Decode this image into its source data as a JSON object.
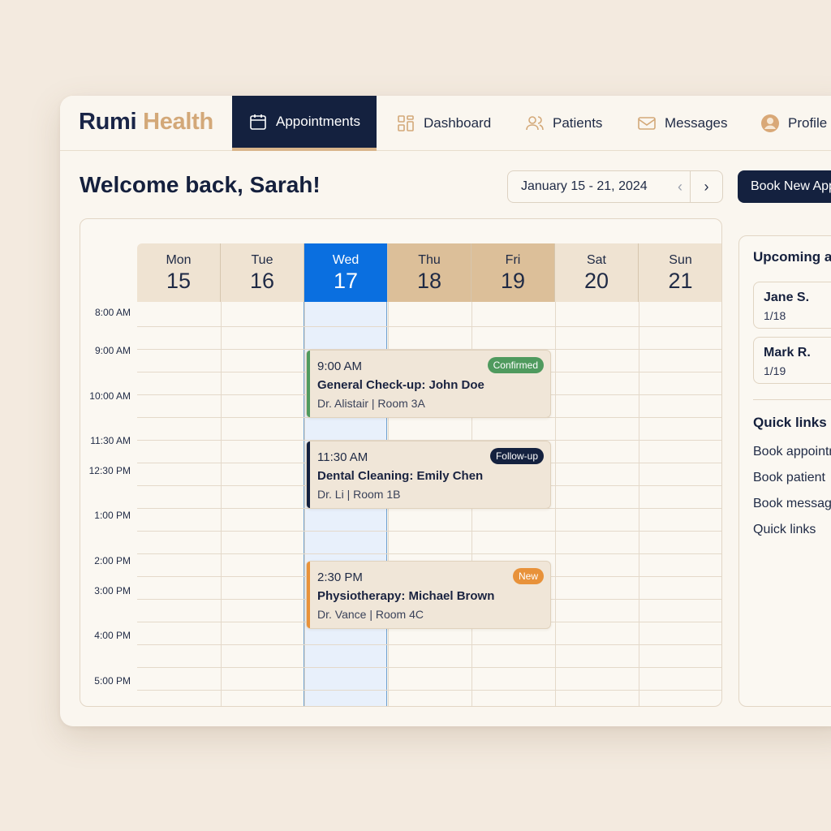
{
  "brand": {
    "part1": "Rumi",
    "part2": "Health"
  },
  "nav": {
    "appointments": "Appointments",
    "dashboard": "Dashboard",
    "patients": "Patients",
    "messages": "Messages",
    "profile": "Profile"
  },
  "header": {
    "welcome": "Welcome back, Sarah!",
    "date_range": "January 15 - 21, 2024",
    "prev_icon": "chevron-left-icon",
    "next_icon": "chevron-right-icon",
    "book_button": "Book New Appointment"
  },
  "calendar": {
    "days": [
      {
        "name": "Mon",
        "num": "15",
        "state": "default"
      },
      {
        "name": "Tue",
        "num": "16",
        "state": "default"
      },
      {
        "name": "Wed",
        "num": "17",
        "state": "today"
      },
      {
        "name": "Thu",
        "num": "18",
        "state": "booked"
      },
      {
        "name": "Fri",
        "num": "19",
        "state": "booked"
      },
      {
        "name": "Sat",
        "num": "20",
        "state": "default"
      },
      {
        "name": "Sun",
        "num": "21",
        "state": "default"
      }
    ],
    "times": [
      "8:00 AM",
      "9:00 AM",
      "10:00 AM",
      "11:30 AM",
      "12:30 PM",
      "1:00 PM",
      "2:00 PM",
      "3:00 PM",
      "4:00 PM",
      "5:00 PM"
    ],
    "appointments": [
      {
        "time": "9:00 AM",
        "title": "General Check-up: John Doe",
        "meta": "Dr. Alistair | Room 3A",
        "badge": "Confirmed",
        "color": "#4f9a5e"
      },
      {
        "time": "11:30 AM",
        "title": "Dental Cleaning: Emily Chen",
        "meta": "Dr. Li | Room 1B",
        "badge": "Follow-up",
        "color": "#14213f"
      },
      {
        "time": "2:30 PM",
        "title": "Physiotherapy: Michael Brown",
        "meta": "Dr. Vance | Room 4C",
        "badge": "New",
        "color": "#e8923a"
      }
    ]
  },
  "side": {
    "upcoming_title": "Upcoming appointments",
    "upcoming": [
      {
        "name": "Jane S.",
        "date": "1/18"
      },
      {
        "name": "Mark R.",
        "date": "1/19"
      }
    ],
    "quick_links_title": "Quick links",
    "quick_links": [
      "Book appointment",
      "Book patient",
      "Book message",
      "Quick links"
    ]
  },
  "colors": {
    "navy": "#14213f",
    "accent_tan": "#d3a878",
    "today_blue": "#0a6fe0",
    "booked_tan": "#dcbf99",
    "header_beige": "#efe3d2",
    "confirmed_green": "#4f9a5e",
    "new_orange": "#e8923a"
  }
}
